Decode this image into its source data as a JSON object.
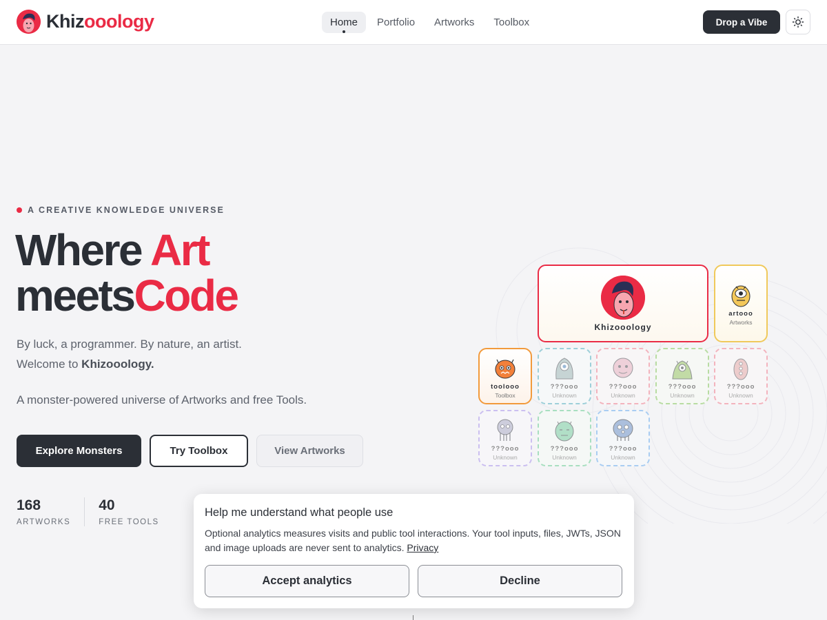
{
  "header": {
    "brand": {
      "part1": "Khiz",
      "part2": "ooology"
    },
    "nav": [
      {
        "label": "Home",
        "active": true
      },
      {
        "label": "Portfolio",
        "active": false
      },
      {
        "label": "Artworks",
        "active": false
      },
      {
        "label": "Toolbox",
        "active": false
      }
    ],
    "cta_label": "Drop a Vibe",
    "theme_icon": "sun-icon"
  },
  "hero": {
    "eyebrow": "A CREATIVE KNOWLEDGE UNIVERSE",
    "title_line1_a": "Where ",
    "title_line1_b": "Art",
    "title_line2_a": "meets",
    "title_line2_b": "Code",
    "subtitle_line1": "By luck, a programmer. By nature, an artist.",
    "subtitle_line2_prefix": "Welcome to ",
    "subtitle_line2_bold": "Khizooology.",
    "tagline": "A monster-powered universe of Artworks and free Tools.",
    "buttons": {
      "primary": "Explore Monsters",
      "secondary": "Try Toolbox",
      "tertiary": "View Artworks"
    },
    "stats": [
      {
        "value": "168",
        "label": "ARTWORKS"
      },
      {
        "value": "40",
        "label": "FREE TOOLS"
      }
    ]
  },
  "monsters": {
    "main": {
      "name": "Khizooology"
    },
    "cards": [
      {
        "name": "artooo",
        "sub": "Artworks",
        "border": "#f0c95a"
      },
      {
        "name": "toolooo",
        "sub": "Toolbox",
        "border": "#f29a3b"
      },
      {
        "name": "???ooo",
        "sub": "Unknown",
        "border": "#9dcfd9"
      },
      {
        "name": "???ooo",
        "sub": "Unknown",
        "border": "#f3b3bd"
      },
      {
        "name": "???ooo",
        "sub": "Unknown",
        "border": "#b8dca2"
      },
      {
        "name": "???ooo",
        "sub": "Unknown",
        "border": "#f3b3bd"
      },
      {
        "name": "???ooo",
        "sub": "Unknown",
        "border": "#cbbff0"
      },
      {
        "name": "???ooo",
        "sub": "Unknown",
        "border": "#a8dfc0"
      },
      {
        "name": "???ooo",
        "sub": "Unknown",
        "border": "#a9cdf2"
      }
    ]
  },
  "cookie": {
    "title": "Help me understand what people use",
    "text": "Optional analytics measures visits and public tool interactions. Your tool inputs, files, JWTs, JSON and image uploads are never sent to analytics. ",
    "link": "Privacy",
    "accept": "Accept analytics",
    "decline": "Decline"
  },
  "colors": {
    "accent": "#ea2b45",
    "dark": "#2b2f36",
    "background": "#f4f4f6"
  }
}
